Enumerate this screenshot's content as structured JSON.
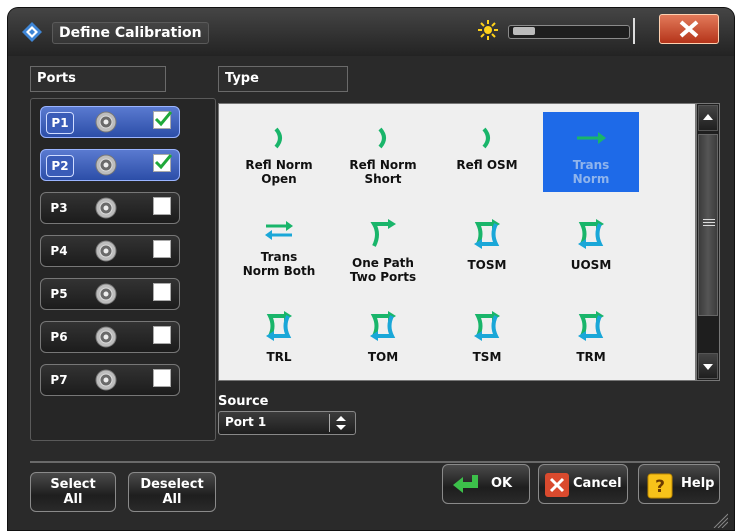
{
  "window": {
    "title": "Define Calibration"
  },
  "ports": {
    "header": "Ports",
    "items": [
      {
        "label": "P1",
        "checked": true
      },
      {
        "label": "P2",
        "checked": true
      },
      {
        "label": "P3",
        "checked": false
      },
      {
        "label": "P4",
        "checked": false
      },
      {
        "label": "P5",
        "checked": false
      },
      {
        "label": "P6",
        "checked": false
      },
      {
        "label": "P7",
        "checked": false
      }
    ]
  },
  "type": {
    "header": "Type",
    "items": [
      {
        "line1": "Refl Norm",
        "line2": "Open",
        "icon": "reflect-icon"
      },
      {
        "line1": "Refl Norm",
        "line2": "Short",
        "icon": "reflect-icon"
      },
      {
        "line1": "Refl OSM",
        "line2": "",
        "icon": "reflect-icon"
      },
      {
        "line1": "Trans",
        "line2": "Norm",
        "icon": "transmission-arrow-icon",
        "selected": true
      },
      {
        "line1": "Trans",
        "line2": "Norm Both",
        "icon": "bidirectional-arrows-icon"
      },
      {
        "line1": "One Path",
        "line2": "Two Ports",
        "icon": "one-path-icon"
      },
      {
        "line1": "TOSM",
        "line2": "",
        "icon": "two-port-cal-icon"
      },
      {
        "line1": "UOSM",
        "line2": "",
        "icon": "two-port-cal-icon"
      },
      {
        "line1": "TRL",
        "line2": "",
        "icon": "two-port-cal-icon"
      },
      {
        "line1": "TOM",
        "line2": "",
        "icon": "two-port-cal-icon"
      },
      {
        "line1": "TSM",
        "line2": "",
        "icon": "two-port-cal-icon"
      },
      {
        "line1": "TRM",
        "line2": "",
        "icon": "two-port-cal-icon"
      },
      {
        "line1": "",
        "line2": "",
        "icon": "two-port-cal-icon"
      }
    ]
  },
  "source": {
    "label": "Source",
    "value": "Port 1"
  },
  "buttons": {
    "select_all_1": "Select",
    "select_all_2": "All",
    "deselect_all_1": "Deselect",
    "deselect_all_2": "All",
    "ok": "OK",
    "cancel": "Cancel",
    "help": "Help"
  },
  "colors": {
    "selection_blue": "#1e6ae8",
    "icon_green": "#19b56a",
    "icon_cyan": "#1aa7d8",
    "close_red": "#c8452a"
  }
}
